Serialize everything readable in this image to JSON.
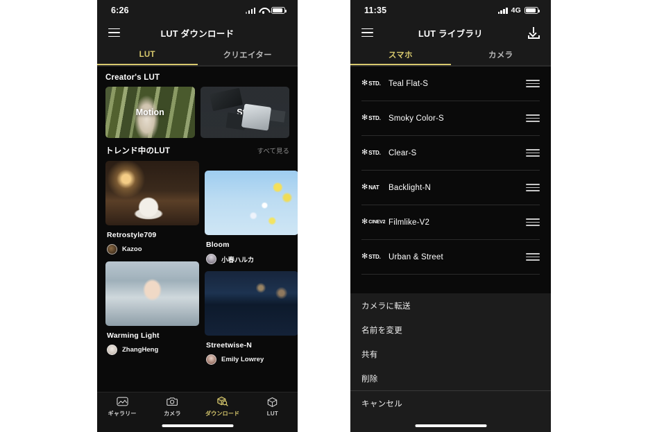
{
  "left_phone": {
    "statusbar": {
      "time": "6:26",
      "signal_icon": "signal-bars-icon",
      "wifi_icon": "wifi-icon",
      "battery_icon": "battery-icon"
    },
    "navbar": {
      "menu_icon": "hamburger-menu-icon",
      "title": "LUT ダウンロード"
    },
    "tabs": [
      {
        "label": "LUT",
        "active": true
      },
      {
        "label": "クリエイター",
        "active": false
      }
    ],
    "creator_section": {
      "title": "Creator's LUT",
      "cards": [
        {
          "caption": "Motion",
          "photo": "ph-motion"
        },
        {
          "caption": "Still",
          "photo": "ph-still"
        }
      ]
    },
    "trending_section": {
      "title": "トレンド中のLUT",
      "more_label": "すべて見る",
      "items_left": [
        {
          "name": "Retrostyle709",
          "author": "Kazoo",
          "photo": "ph-cafe",
          "avatar": "av-kazoo"
        },
        {
          "name": "Warming Light",
          "author": "ZhangHeng",
          "photo": "ph-warm",
          "avatar": "av-zhang"
        }
      ],
      "items_right": [
        {
          "name": "Bloom",
          "author": "小春ハルカ",
          "photo": "ph-bloom",
          "avatar": "av-haruka"
        },
        {
          "name": "Streetwise-N",
          "author": "Emily Lowrey",
          "photo": "ph-street",
          "avatar": "av-emily"
        }
      ]
    },
    "tabbar": [
      {
        "label": "ギャラリー",
        "icon": "gallery-icon",
        "active": false
      },
      {
        "label": "カメラ",
        "icon": "camera-icon",
        "active": false
      },
      {
        "label": "ダウンロード",
        "icon": "download-cube-search-icon",
        "active": true
      },
      {
        "label": "LUT",
        "icon": "cube-icon",
        "active": false
      }
    ]
  },
  "right_phone": {
    "statusbar": {
      "time": "11:35",
      "signal_icon": "signal-bars-icon",
      "network": "4G",
      "battery_icon": "battery-icon"
    },
    "navbar": {
      "menu_icon": "hamburger-menu-icon",
      "title": "LUT ライブラリ",
      "download_icon": "download-icon"
    },
    "tabs": [
      {
        "label": "スマホ",
        "active": true
      },
      {
        "label": "カメラ",
        "active": false
      }
    ],
    "lut_list": [
      {
        "badge": "STD.",
        "name": "Teal Flat-S"
      },
      {
        "badge": "STD.",
        "name": "Smoky Color-S"
      },
      {
        "badge": "STD.",
        "name": "Clear-S"
      },
      {
        "badge": "NAT",
        "name": "Backlight-N"
      },
      {
        "badge": "CINEV2",
        "name": "Filmlike-V2"
      },
      {
        "badge": "STD.",
        "name": "Urban & Street"
      }
    ],
    "action_sheet": {
      "items": [
        {
          "label": "カメラに転送",
          "separator_after": false
        },
        {
          "label": "名前を変更",
          "separator_after": false
        },
        {
          "label": "共有",
          "separator_after": false
        },
        {
          "label": "削除",
          "separator_after": true
        },
        {
          "label": "キャンセル",
          "separator_after": false
        }
      ]
    }
  },
  "colors": {
    "accent": "#d8c96d",
    "background": "#0a0a0a",
    "bar": "#1a1a1a",
    "sheet": "#1c1c1c",
    "page": "#ffffff"
  }
}
